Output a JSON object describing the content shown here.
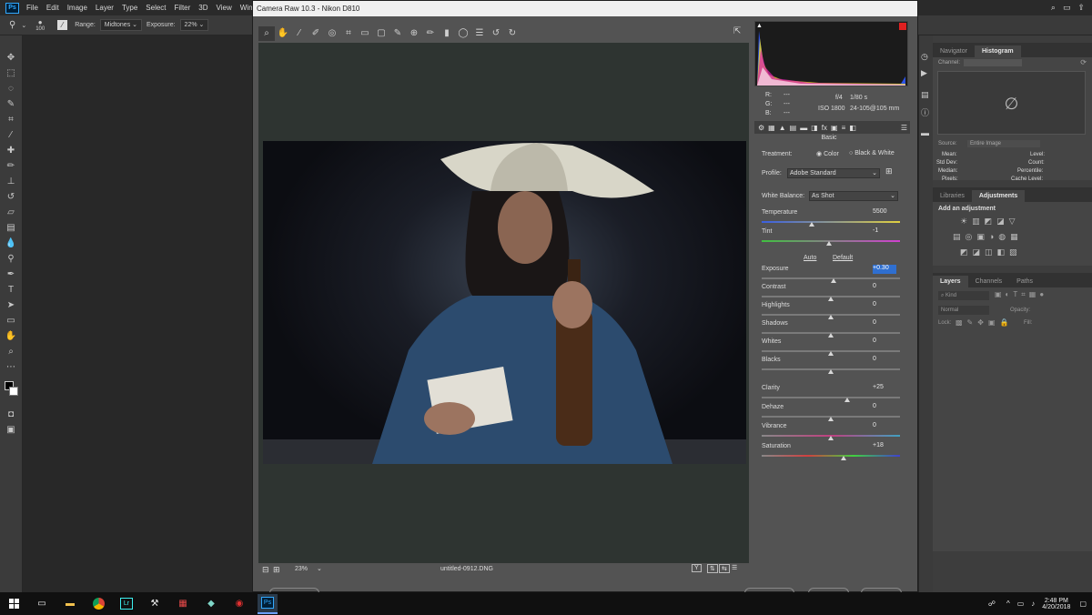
{
  "menubar": {
    "items": [
      "File",
      "Edit",
      "Image",
      "Layer",
      "Type",
      "Select",
      "Filter",
      "3D",
      "View",
      "Window"
    ]
  },
  "options": {
    "brush_size": "100",
    "range_label": "Range:",
    "range_value": "Midtones",
    "exposure_label": "Exposure:",
    "exposure_value": "22%"
  },
  "camera_raw": {
    "title": "Camera Raw 10.3  -  Nikon D810",
    "exif": {
      "r": "R:",
      "g": "G:",
      "b": "B:",
      "dash": "---",
      "aperture": "f/4",
      "shutter": "1/80 s",
      "iso": "ISO 1800",
      "lens": "24-105@105 mm"
    },
    "panel_title": "Basic",
    "treatment_label": "Treatment:",
    "treatment_color": "Color",
    "treatment_bw": "Black & White",
    "profile_label": "Profile:",
    "profile_value": "Adobe Standard",
    "wb_label": "White Balance:",
    "wb_value": "As Shot",
    "auto": "Auto",
    "default": "Default",
    "sliders": [
      {
        "label": "Temperature",
        "value": "5500",
        "pos": 0.36
      },
      {
        "label": "Tint",
        "value": "-1",
        "pos": 0.49
      },
      {
        "label": "Exposure",
        "value": "+0.30",
        "pos": 0.52
      },
      {
        "label": "Contrast",
        "value": "0",
        "pos": 0.5
      },
      {
        "label": "Highlights",
        "value": "0",
        "pos": 0.5
      },
      {
        "label": "Shadows",
        "value": "0",
        "pos": 0.5
      },
      {
        "label": "Whites",
        "value": "0",
        "pos": 0.5
      },
      {
        "label": "Blacks",
        "value": "0",
        "pos": 0.5
      },
      {
        "label": "Clarity",
        "value": "+25",
        "pos": 0.62
      },
      {
        "label": "Dehaze",
        "value": "0",
        "pos": 0.5
      },
      {
        "label": "Vibrance",
        "value": "0",
        "pos": 0.5
      },
      {
        "label": "Saturation",
        "value": "+18",
        "pos": 0.59
      }
    ],
    "zoom": "23%",
    "filename": "untitled-0912.DNG"
  },
  "histogram_panel": {
    "tabs": [
      "Navigator",
      "Histogram"
    ],
    "channel_label": "Channel:",
    "source_label": "Source:",
    "source_value": "Entire Image",
    "mean": "Mean:",
    "std_dev": "Std Dev:",
    "median": "Median:",
    "pixels": "Pixels:",
    "level": "Level:",
    "count": "Count:",
    "percentile": "Percentile:",
    "cache_level": "Cache Level:"
  },
  "adjustments_panel": {
    "tabs": [
      "Libraries",
      "Adjustments"
    ],
    "heading": "Add an adjustment"
  },
  "layers_panel": {
    "tabs": [
      "Layers",
      "Channels",
      "Paths"
    ],
    "kind": "Kind",
    "blend": "Normal",
    "opacity": "Opacity:",
    "lock": "Lock:",
    "fill": "Fill:"
  },
  "taskbar": {
    "time": "2:48 PM",
    "date": "4/20/2018",
    "ps_label": "Ps",
    "lr_label": "Lr"
  }
}
